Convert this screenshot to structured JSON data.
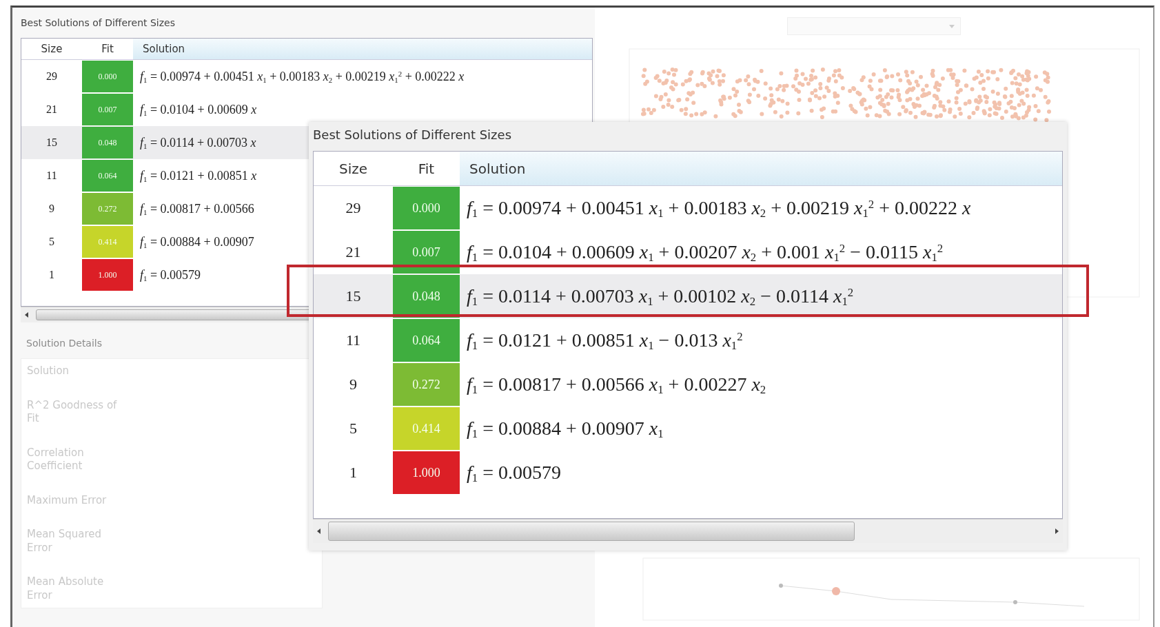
{
  "background_window": {
    "title": "Best Solutions of Different Sizes",
    "table": {
      "columns": [
        "Size",
        "Fit",
        "Solution"
      ],
      "rows": [
        {
          "size": "29",
          "fit": "0.000",
          "color": "#3fae3f",
          "selected": false,
          "solution": "*f*$_{1}$ = 0.00974 + 0.00451 *x*$_{1}$ + 0.00183 *x*$_{2}$ + 0.00219 *x*$_{1}$$^{2}$ + 0.00222 *x*"
        },
        {
          "size": "21",
          "fit": "0.007",
          "color": "#3fae3f",
          "selected": false,
          "solution": "*f*$_{1}$ = 0.0104 + 0.00609 *x*"
        },
        {
          "size": "15",
          "fit": "0.048",
          "color": "#3fae3f",
          "selected": true,
          "solution": "*f*$_{1}$ = 0.0114 + 0.00703 *x*"
        },
        {
          "size": "11",
          "fit": "0.064",
          "color": "#3fae3f",
          "selected": false,
          "solution": "*f*$_{1}$ = 0.0121 + 0.00851 *x*"
        },
        {
          "size": "9",
          "fit": "0.272",
          "color": "#7dbb34",
          "selected": false,
          "solution": "*f*$_{1}$ = 0.00817 + 0.00566"
        },
        {
          "size": "5",
          "fit": "0.414",
          "color": "#c6d52a",
          "selected": false,
          "solution": "*f*$_{1}$ = 0.00884 + 0.00907"
        },
        {
          "size": "1",
          "fit": "1.000",
          "color": "#dc1f26",
          "selected": false,
          "solution": "*f*$_{1}$ = 0.00579"
        }
      ]
    },
    "details": {
      "title": "Solution Details",
      "labels": [
        "Solution",
        "R^2 Goodness of Fit",
        "Correlation Coefficient",
        "Maximum Error",
        "Mean Squared Error",
        "Mean Absolute Error"
      ]
    }
  },
  "callout": {
    "title": "Best Solutions of Different Sizes",
    "table": {
      "columns": [
        "Size",
        "Fit",
        "Solution"
      ],
      "rows": [
        {
          "size": "29",
          "fit": "0.000",
          "color": "#3fae3f",
          "selected": false,
          "solution": "*f*$_{1}$ = 0.00974 + 0.00451 *x*$_{1}$ + 0.00183 *x*$_{2}$ + 0.00219 *x*$_{1}$$^{2}$ + 0.00222 *x*"
        },
        {
          "size": "21",
          "fit": "0.007",
          "color": "#3fae3f",
          "selected": false,
          "solution": "*f*$_{1}$ = 0.0104 + 0.00609 *x*$_{1}$ + 0.00207 *x*$_{2}$ + 0.001 *x*$_{1}$$^{2}$ − 0.0115 *x*$_{1}$$^{2}$"
        },
        {
          "size": "15",
          "fit": "0.048",
          "color": "#3fae3f",
          "selected": true,
          "solution": "*f*$_{1}$ = 0.0114 + 0.00703 *x*$_{1}$ + 0.00102 *x*$_{2}$ − 0.0114 *x*$_{1}$$^{2}$"
        },
        {
          "size": "11",
          "fit": "0.064",
          "color": "#3fae3f",
          "selected": false,
          "solution": "*f*$_{1}$ = 0.0121 + 0.00851 *x*$_{1}$ − 0.013 *x*$_{1}$$^{2}$"
        },
        {
          "size": "9",
          "fit": "0.272",
          "color": "#7dbb34",
          "selected": false,
          "solution": "*f*$_{1}$ = 0.00817 + 0.00566 *x*$_{1}$ + 0.00227 *x*$_{2}$"
        },
        {
          "size": "5",
          "fit": "0.414",
          "color": "#c6d52a",
          "selected": false,
          "solution": "*f*$_{1}$ = 0.00884 + 0.00907 *x*$_{1}$"
        },
        {
          "size": "1",
          "fit": "1.000",
          "color": "#dc1f26",
          "selected": false,
          "solution": "*f*$_{1}$ = 0.00579"
        }
      ]
    }
  }
}
